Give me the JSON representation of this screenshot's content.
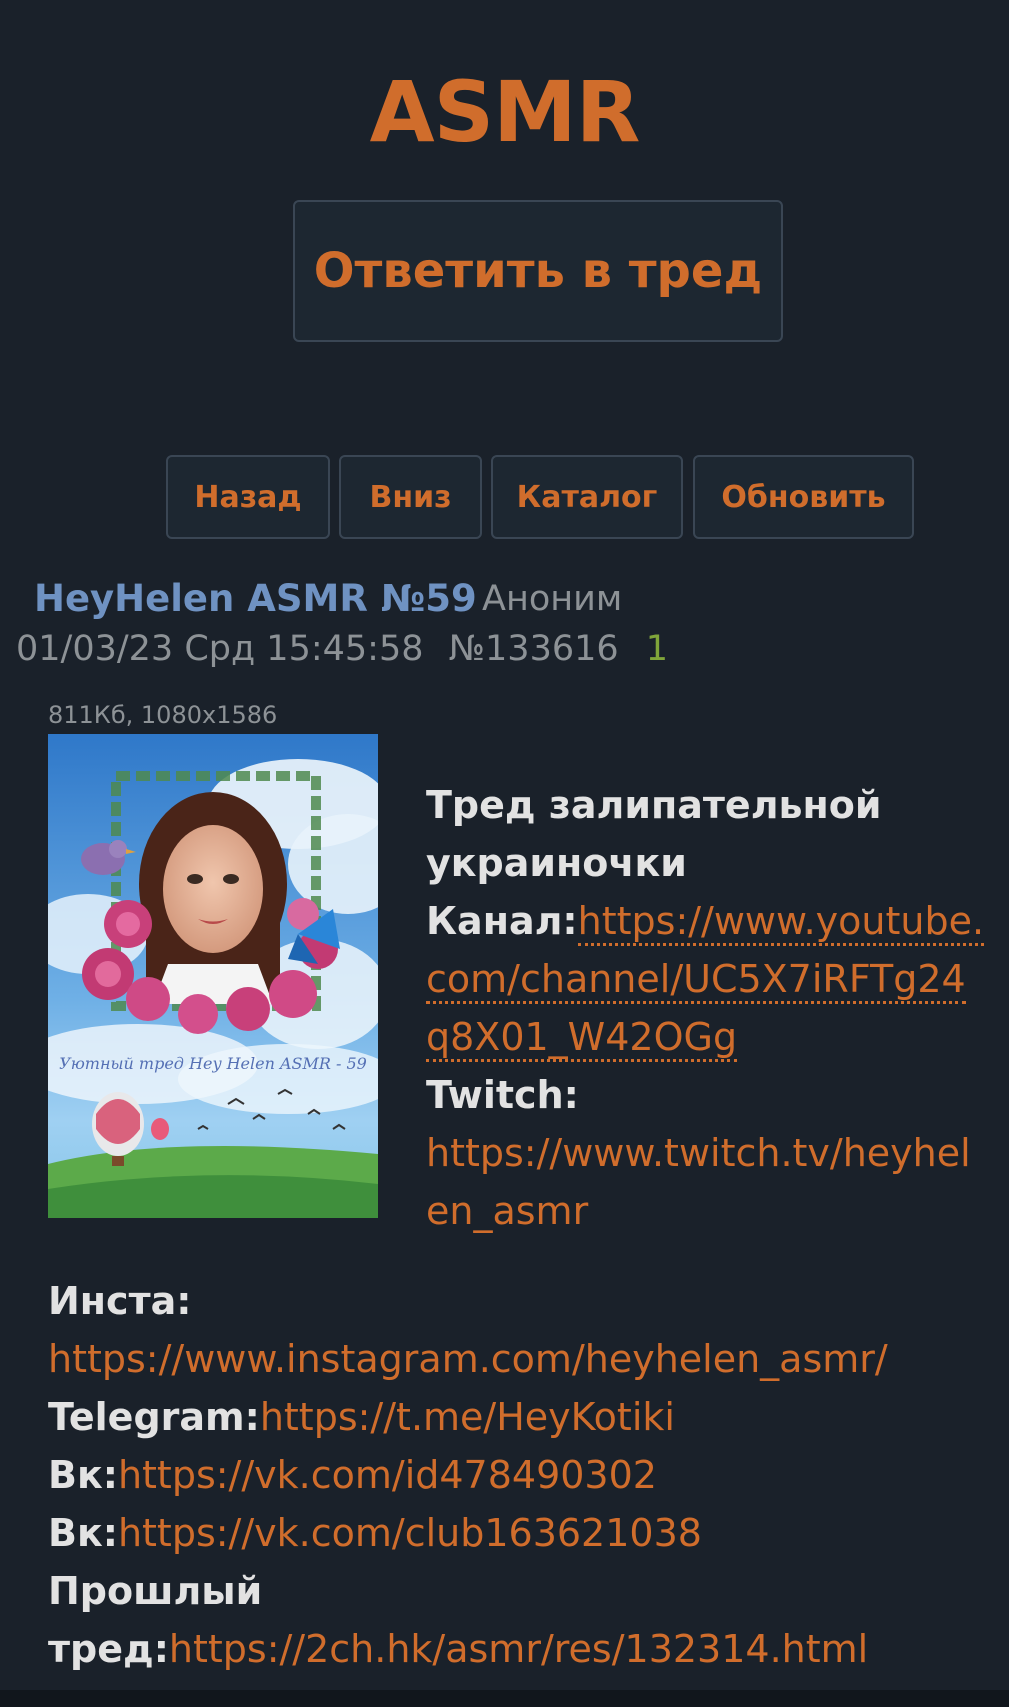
{
  "board": {
    "title": "ASMR"
  },
  "reply_button": {
    "label": "Ответить в тред"
  },
  "nav": {
    "back": "Назад",
    "down": "Вниз",
    "catalog": "Каталог",
    "refresh": "Обновить"
  },
  "post": {
    "subject": "HeyHelen ASMR №59",
    "name": "Аноним",
    "date": "01/03/23 Срд 15:45:58",
    "number": "№133616",
    "replies": "1",
    "file_info": "811Кб, 1080x1586",
    "image_caption": "Уютный тред Hey Helen ASMR - 59",
    "text": {
      "title_line1": "Тред залипательной",
      "title_line2": "украиночки",
      "channel_label": "Канал:",
      "channel_link": "https://www.youtube.com/channel/UC5X7iRFTg24q8X01_W42OGg",
      "twitch_label": "Twitch:",
      "twitch_link": "https://www.twitch.tv/heyhelen_asmr",
      "insta_label": "Инста:",
      "insta_link": "https://www.instagram.com/heyhelen_asmr/",
      "telegram_label": "Telegram:",
      "telegram_link": "https://t.me/HeyKotiki",
      "vk1_label": "Вк:",
      "vk1_link": "https://vk.com/id478490302",
      "vk2_label": "Вк:",
      "vk2_link": "https://vk.com/club163621038",
      "prev_label_line1": "Прошлый",
      "prev_label_line2": "тред:",
      "prev_link": "https://2ch.hk/asmr/res/132314.html"
    }
  },
  "colors": {
    "background": "#1a212a",
    "accent": "#d06d2c",
    "subject": "#6f92c2",
    "meta": "#8d9296",
    "replies": "#80a53a"
  }
}
